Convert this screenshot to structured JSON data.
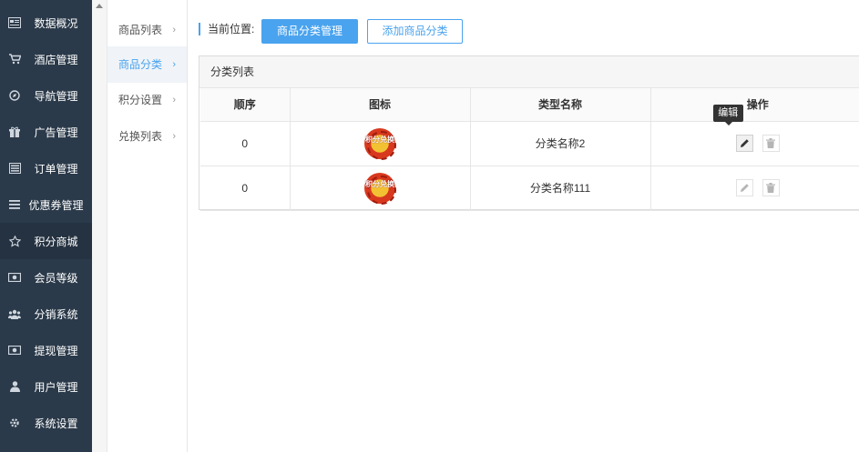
{
  "sidebar": {
    "items": [
      {
        "label": "数据概况",
        "icon": "dashboard-icon"
      },
      {
        "label": "酒店管理",
        "icon": "cart-icon"
      },
      {
        "label": "导航管理",
        "icon": "compass-icon"
      },
      {
        "label": "广告管理",
        "icon": "gift-icon"
      },
      {
        "label": "订单管理",
        "icon": "server-icon"
      },
      {
        "label": "优惠券管理",
        "icon": "list-icon"
      },
      {
        "label": "积分商城",
        "icon": "star-icon",
        "active": true
      },
      {
        "label": "会员等级",
        "icon": "money-icon"
      },
      {
        "label": "分销系统",
        "icon": "users-icon"
      },
      {
        "label": "提现管理",
        "icon": "money-icon"
      },
      {
        "label": "用户管理",
        "icon": "user-icon"
      },
      {
        "label": "系统设置",
        "icon": "gear-icon"
      }
    ]
  },
  "submenu": {
    "items": [
      {
        "label": "商品列表"
      },
      {
        "label": "商品分类",
        "active": true
      },
      {
        "label": "积分设置"
      },
      {
        "label": "兑换列表"
      }
    ],
    "chevron": "›"
  },
  "breadcrumb": {
    "label": "当前位置:"
  },
  "toolbar": {
    "current_label": "商品分类管理",
    "add_label": "添加商品分类"
  },
  "panel": {
    "title": "分类列表"
  },
  "table": {
    "headers": [
      "顺序",
      "图标",
      "类型名称",
      "操作"
    ],
    "rows": [
      {
        "order": "0",
        "icon_text": "积分兑换",
        "name": "分类名称2"
      },
      {
        "order": "0",
        "icon_text": "积分兑换",
        "name": "分类名称111"
      }
    ]
  },
  "tooltip": {
    "edit": "编辑"
  },
  "colors": {
    "sidebar_bg": "#2b3a4a",
    "accent": "#4aa3ee"
  }
}
